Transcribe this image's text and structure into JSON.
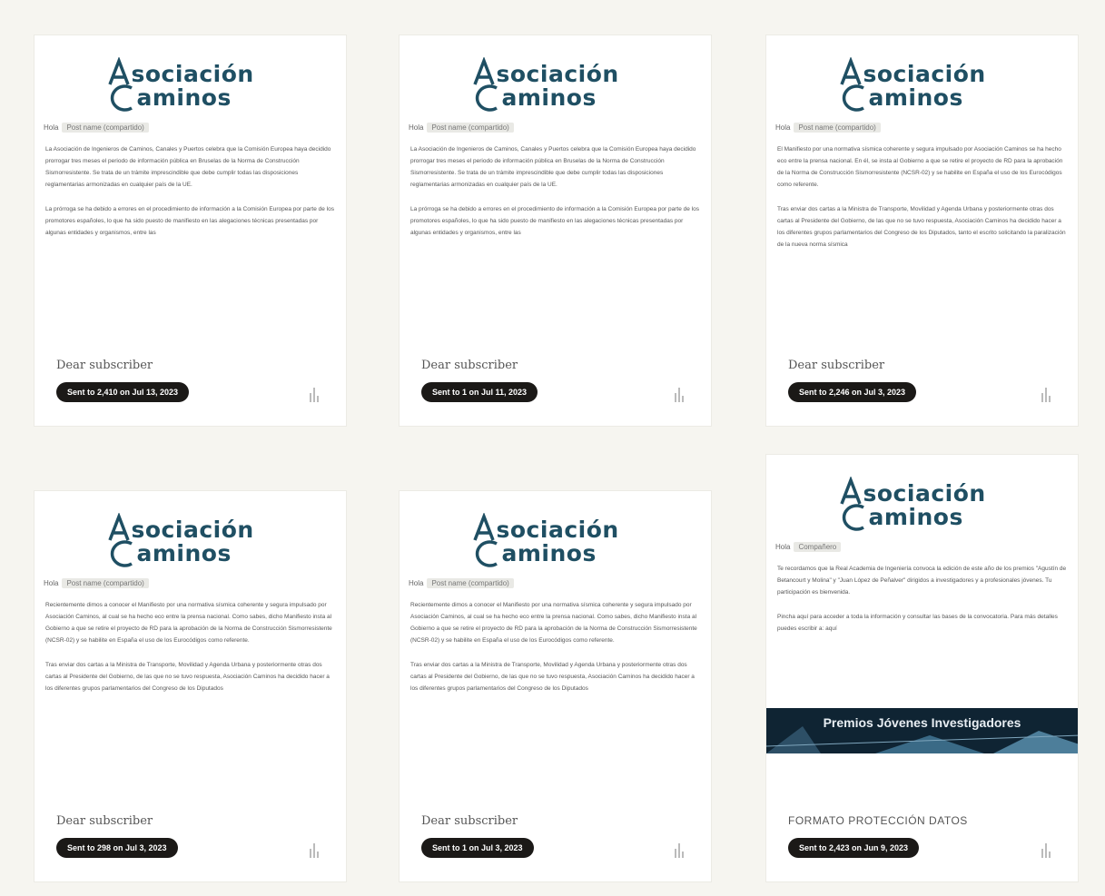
{
  "cards": [
    {
      "logo_line1": "sociación",
      "logo_line2": "aminos",
      "crumb_label": "Hola",
      "crumb_tag": "Post name (compartido)",
      "p1": "La Asociación de Ingenieros de Caminos, Canales y Puertos celebra que la Comisión Europea haya decidido prorrogar tres meses el periodo de información pública en Bruselas de la Norma de Construcción Sismorresistente. Se trata de un trámite imprescindible que debe cumplir todas las disposiciones reglamentarias armonizadas en cualquier país de la UE.",
      "p2": "La prórroga se ha debido a errores en el procedimiento de información a la Comisión Europea por parte de los promotores españoles, lo que ha sido puesto de manifiesto en las alegaciones técnicas presentadas por algunas entidades y organismos, entre las",
      "greeting": "Dear subscriber",
      "sent": "Sent to 2,410 on Jul 13, 2023"
    },
    {
      "logo_line1": "sociación",
      "logo_line2": "aminos",
      "crumb_label": "Hola",
      "crumb_tag": "Post name (compartido)",
      "p1": "La Asociación de Ingenieros de Caminos, Canales y Puertos celebra que la Comisión Europea haya decidido prorrogar tres meses el periodo de información pública en Bruselas de la Norma de Construcción Sismorresistente. Se trata de un trámite imprescindible que debe cumplir todas las disposiciones reglamentarias armonizadas en cualquier país de la UE.",
      "p2": "La prórroga se ha debido a errores en el procedimiento de información a la Comisión Europea por parte de los promotores españoles, lo que ha sido puesto de manifiesto en las alegaciones técnicas presentadas por algunas entidades y organismos, entre las",
      "greeting": "Dear subscriber",
      "sent": "Sent to 1 on Jul 11, 2023"
    },
    {
      "logo_line1": "sociación",
      "logo_line2": "aminos",
      "crumb_label": "Hola",
      "crumb_tag": "Post name (compartido)",
      "p1": "El Manifiesto por una normativa sísmica coherente y segura impulsado por Asociación Caminos se ha hecho eco entre la prensa nacional. En él, se insta al Gobierno a que se retire el proyecto de RD para la aprobación de la Norma de Construcción Sismorresistente (NCSR-02) y se habilite en España el uso de los Eurocódigos como referente.",
      "p2": "Tras enviar dos cartas a la Ministra de Transporte, Movilidad y Agenda Urbana y posteriormente otras dos cartas al Presidente del Gobierno, de las que no se tuvo respuesta, Asociación Caminos ha decidido hacer a los diferentes grupos parlamentarios del Congreso de los Diputados, tanto el escrito solicitando la paralización de la nueva norma sísmica",
      "greeting": "Dear subscriber",
      "sent": "Sent to 2,246 on Jul 3, 2023"
    },
    {
      "logo_line1": "sociación",
      "logo_line2": "aminos",
      "crumb_label": "Hola",
      "crumb_tag": "Post name (compartido)",
      "p1": "Recientemente dimos a conocer el Manifiesto por una normativa sísmica coherente y segura impulsado por Asociación Caminos, al cual se ha hecho eco entre la prensa nacional. Como sabes, dicho Manifiesto insta al Gobierno a que se retire el proyecto de RD para la aprobación de la Norma de Construcción Sismorresistente (NCSR-02) y se habilite en España el uso de los Eurocódigos como referente.",
      "p2": "Tras enviar dos cartas a la Ministra de Transporte, Movilidad y Agenda Urbana y posteriormente otras dos cartas al Presidente del Gobierno, de las que no se tuvo respuesta, Asociación Caminos ha decidido hacer a los diferentes grupos parlamentarios del Congreso de los Diputados",
      "greeting": "Dear subscriber",
      "sent": "Sent to 298 on Jul 3, 2023"
    },
    {
      "logo_line1": "sociación",
      "logo_line2": "aminos",
      "crumb_label": "Hola",
      "crumb_tag": "Post name (compartido)",
      "p1": "Recientemente dimos a conocer el Manifiesto por una normativa sísmica coherente y segura impulsado por Asociación Caminos, al cual se ha hecho eco entre la prensa nacional. Como sabes, dicho Manifiesto insta al Gobierno a que se retire el proyecto de RD para la aprobación de la Norma de Construcción Sismorresistente (NCSR-02) y se habilite en España el uso de los Eurocódigos como referente.",
      "p2": "Tras enviar dos cartas a la Ministra de Transporte, Movilidad y Agenda Urbana y posteriormente otras dos cartas al Presidente del Gobierno, de las que no se tuvo respuesta, Asociación Caminos ha decidido hacer a los diferentes grupos parlamentarios del Congreso de los Diputados",
      "greeting": "Dear subscriber",
      "sent": "Sent to 1 on Jul 3, 2023"
    },
    {
      "logo_line1": "sociación",
      "logo_line2": "aminos",
      "crumb_label": "Hola",
      "crumb_tag": "Compañero",
      "p1": "Te recordamos que la Real Academia de Ingeniería convoca la edición de este año de los premios \"Agustín de Betancourt y Molina\" y \"Juan López de Peñalver\" dirigidos a investigadores y a profesionales jóvenes. Tu participación es bienvenida.",
      "p2": "Pincha aquí para acceder a toda la información y consultar las bases de la convocatoria. Para más detalles puedes escribir a: aquí",
      "banner_title": "Premios Jóvenes Investigadores",
      "greeting": "FORMATO PROTECCIÓN DATOS",
      "sent": "Sent to 2,423 on Jun 9, 2023"
    }
  ],
  "colors": {
    "brand": "#1f4f63",
    "badge_bg": "#1b1917",
    "page_bg": "#f6f5f0",
    "banner_bg": "#0f2433"
  },
  "icons": {
    "logo": "asociacion-caminos-logo",
    "stats": "bar-chart-icon"
  }
}
